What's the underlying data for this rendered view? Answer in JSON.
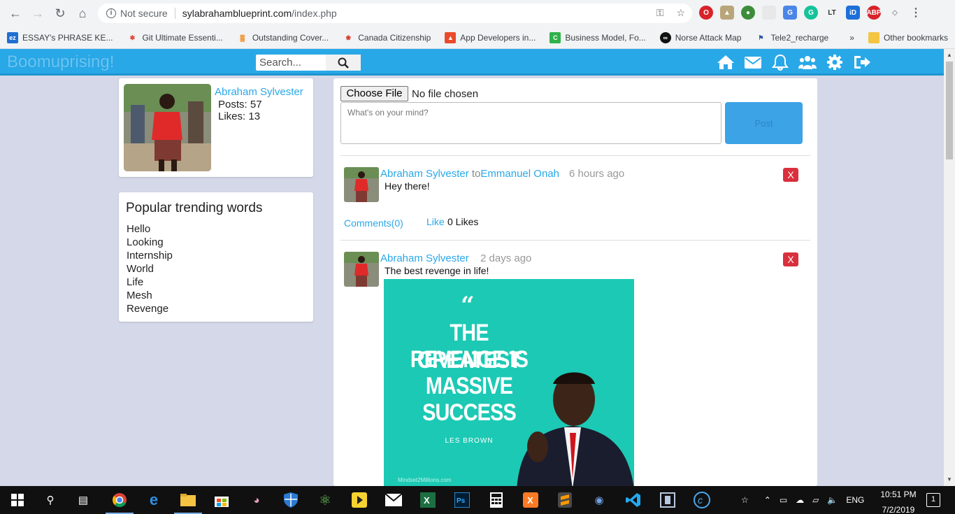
{
  "browser": {
    "security_label": "Not secure",
    "url_domain": "sylabrahamblueprint.com",
    "url_path": "/index.php",
    "bookmarks": [
      {
        "label": "ESSAY's PHRASE KE...",
        "icon": "ez-icon",
        "color": "#1f6fd1",
        "glyph": "ez"
      },
      {
        "label": "Git Ultimate Essenti...",
        "icon": "git-icon",
        "color": "#e0463a",
        "glyph": "✱"
      },
      {
        "label": "Outstanding Cover...",
        "icon": "chart-icon",
        "color": "#f08a24",
        "glyph": "▓"
      },
      {
        "label": "Canada Citizenship",
        "icon": "maple-leaf-icon",
        "color": "#d52b1e",
        "glyph": "❀"
      },
      {
        "label": "App Developers in...",
        "icon": "triangle-icon",
        "color": "#e94b2b",
        "glyph": "▲"
      },
      {
        "label": "Business Model, Fo...",
        "icon": "c-icon",
        "color": "#2fb24a",
        "glyph": "C"
      },
      {
        "label": "Norse Attack Map",
        "icon": "norse-icon",
        "color": "#111111",
        "glyph": "∞"
      },
      {
        "label": "Tele2_recharge",
        "icon": "flag-icon",
        "color": "#3055a6",
        "glyph": "⚑"
      }
    ],
    "bookmarks_more": "»",
    "other_bookmarks": "Other bookmarks"
  },
  "site": {
    "brand": "Boomuprising!",
    "search_placeholder": "Search..."
  },
  "profile": {
    "name": "Abraham Sylvester",
    "posts": "Posts: 57",
    "likes": "Likes: 13"
  },
  "trending": {
    "title": "Popular trending words",
    "words": [
      "Hello",
      "Looking",
      "Internship",
      "World",
      "Life",
      "Mesh",
      "Revenge"
    ]
  },
  "composer": {
    "file_button": "Choose File",
    "file_status": "No file chosen",
    "placeholder": "What's on your mind?",
    "post_button": "Post"
  },
  "posts": [
    {
      "author": "Abraham Sylvester",
      "to_word": "to",
      "recipient": "Emmanuel Onah",
      "time": "6 hours ago",
      "content": "Hey there!",
      "delete_label": "X",
      "comments": "Comments(0)",
      "like_label": "Like",
      "likes": "0 Likes"
    },
    {
      "author": "Abraham Sylvester",
      "time": "2 days ago",
      "content": "The best revenge in life!",
      "delete_label": "X",
      "image": {
        "quote_mark": "“",
        "lines": [
          "THE GREATEST",
          "REVENGE IS",
          "MASSIVE",
          "SUCCESS"
        ],
        "author": "LES BROWN",
        "site": "Mindset2Millions.com"
      }
    }
  ],
  "taskbar": {
    "lang": "ENG",
    "time": "10:51 PM",
    "date": "7/2/2019",
    "notifications": "1"
  },
  "colors": {
    "header": "#29a8e8",
    "accent": "#29a8e8",
    "delete": "#d9303e",
    "page_bg": "#d4d8e8"
  }
}
